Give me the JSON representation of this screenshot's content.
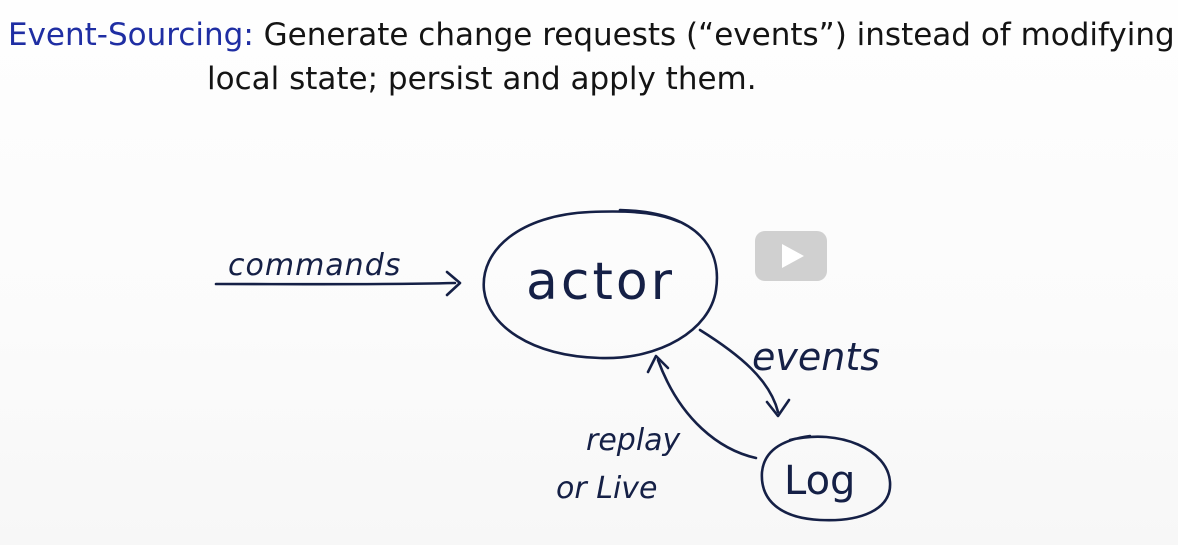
{
  "slide": {
    "term": "Event-Sourcing:",
    "definition_line1": "Generate change requests (“events”) instead of modifying",
    "definition_line2": "local state; persist and apply them."
  },
  "diagram": {
    "commands_label": "commands",
    "actor_label": "actor",
    "events_label": "events",
    "log_label": "Log",
    "replay_label": "replay",
    "live_label": "or Live"
  },
  "colors": {
    "term": "#1f2ea3",
    "ink": "#152046"
  },
  "icons": {
    "play": "play-icon"
  }
}
